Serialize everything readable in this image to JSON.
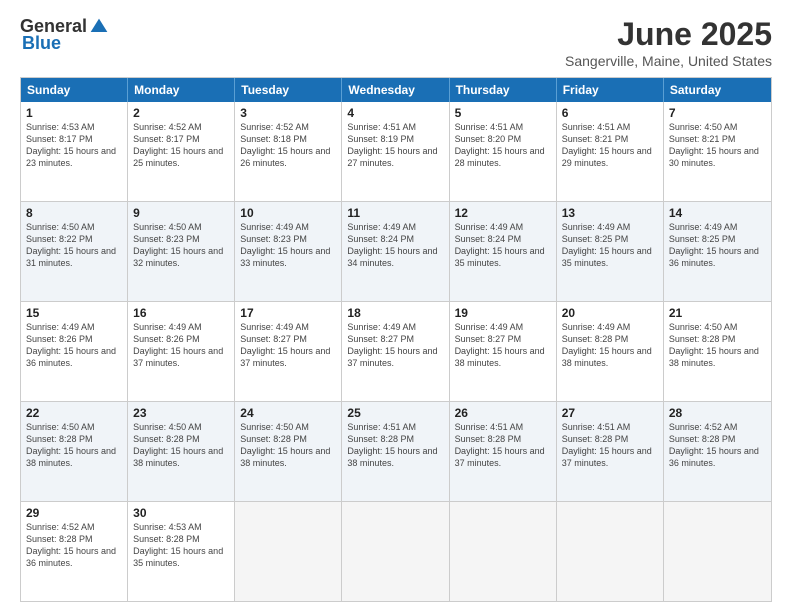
{
  "header": {
    "logo_general": "General",
    "logo_blue": "Blue",
    "title": "June 2025",
    "location": "Sangerville, Maine, United States"
  },
  "days_of_week": [
    "Sunday",
    "Monday",
    "Tuesday",
    "Wednesday",
    "Thursday",
    "Friday",
    "Saturday"
  ],
  "rows": [
    [
      {
        "day": "1",
        "sunrise": "4:53 AM",
        "sunset": "8:17 PM",
        "daylight": "15 hours and 23 minutes.",
        "shaded": false
      },
      {
        "day": "2",
        "sunrise": "4:52 AM",
        "sunset": "8:17 PM",
        "daylight": "15 hours and 25 minutes.",
        "shaded": false
      },
      {
        "day": "3",
        "sunrise": "4:52 AM",
        "sunset": "8:18 PM",
        "daylight": "15 hours and 26 minutes.",
        "shaded": false
      },
      {
        "day": "4",
        "sunrise": "4:51 AM",
        "sunset": "8:19 PM",
        "daylight": "15 hours and 27 minutes.",
        "shaded": false
      },
      {
        "day": "5",
        "sunrise": "4:51 AM",
        "sunset": "8:20 PM",
        "daylight": "15 hours and 28 minutes.",
        "shaded": false
      },
      {
        "day": "6",
        "sunrise": "4:51 AM",
        "sunset": "8:21 PM",
        "daylight": "15 hours and 29 minutes.",
        "shaded": false
      },
      {
        "day": "7",
        "sunrise": "4:50 AM",
        "sunset": "8:21 PM",
        "daylight": "15 hours and 30 minutes.",
        "shaded": false
      }
    ],
    [
      {
        "day": "8",
        "sunrise": "4:50 AM",
        "sunset": "8:22 PM",
        "daylight": "15 hours and 31 minutes.",
        "shaded": true
      },
      {
        "day": "9",
        "sunrise": "4:50 AM",
        "sunset": "8:23 PM",
        "daylight": "15 hours and 32 minutes.",
        "shaded": true
      },
      {
        "day": "10",
        "sunrise": "4:49 AM",
        "sunset": "8:23 PM",
        "daylight": "15 hours and 33 minutes.",
        "shaded": true
      },
      {
        "day": "11",
        "sunrise": "4:49 AM",
        "sunset": "8:24 PM",
        "daylight": "15 hours and 34 minutes.",
        "shaded": true
      },
      {
        "day": "12",
        "sunrise": "4:49 AM",
        "sunset": "8:24 PM",
        "daylight": "15 hours and 35 minutes.",
        "shaded": true
      },
      {
        "day": "13",
        "sunrise": "4:49 AM",
        "sunset": "8:25 PM",
        "daylight": "15 hours and 35 minutes.",
        "shaded": true
      },
      {
        "day": "14",
        "sunrise": "4:49 AM",
        "sunset": "8:25 PM",
        "daylight": "15 hours and 36 minutes.",
        "shaded": true
      }
    ],
    [
      {
        "day": "15",
        "sunrise": "4:49 AM",
        "sunset": "8:26 PM",
        "daylight": "15 hours and 36 minutes.",
        "shaded": false
      },
      {
        "day": "16",
        "sunrise": "4:49 AM",
        "sunset": "8:26 PM",
        "daylight": "15 hours and 37 minutes.",
        "shaded": false
      },
      {
        "day": "17",
        "sunrise": "4:49 AM",
        "sunset": "8:27 PM",
        "daylight": "15 hours and 37 minutes.",
        "shaded": false
      },
      {
        "day": "18",
        "sunrise": "4:49 AM",
        "sunset": "8:27 PM",
        "daylight": "15 hours and 37 minutes.",
        "shaded": false
      },
      {
        "day": "19",
        "sunrise": "4:49 AM",
        "sunset": "8:27 PM",
        "daylight": "15 hours and 38 minutes.",
        "shaded": false
      },
      {
        "day": "20",
        "sunrise": "4:49 AM",
        "sunset": "8:28 PM",
        "daylight": "15 hours and 38 minutes.",
        "shaded": false
      },
      {
        "day": "21",
        "sunrise": "4:50 AM",
        "sunset": "8:28 PM",
        "daylight": "15 hours and 38 minutes.",
        "shaded": false
      }
    ],
    [
      {
        "day": "22",
        "sunrise": "4:50 AM",
        "sunset": "8:28 PM",
        "daylight": "15 hours and 38 minutes.",
        "shaded": true
      },
      {
        "day": "23",
        "sunrise": "4:50 AM",
        "sunset": "8:28 PM",
        "daylight": "15 hours and 38 minutes.",
        "shaded": true
      },
      {
        "day": "24",
        "sunrise": "4:50 AM",
        "sunset": "8:28 PM",
        "daylight": "15 hours and 38 minutes.",
        "shaded": true
      },
      {
        "day": "25",
        "sunrise": "4:51 AM",
        "sunset": "8:28 PM",
        "daylight": "15 hours and 38 minutes.",
        "shaded": true
      },
      {
        "day": "26",
        "sunrise": "4:51 AM",
        "sunset": "8:28 PM",
        "daylight": "15 hours and 37 minutes.",
        "shaded": true
      },
      {
        "day": "27",
        "sunrise": "4:51 AM",
        "sunset": "8:28 PM",
        "daylight": "15 hours and 37 minutes.",
        "shaded": true
      },
      {
        "day": "28",
        "sunrise": "4:52 AM",
        "sunset": "8:28 PM",
        "daylight": "15 hours and 36 minutes.",
        "shaded": true
      }
    ],
    [
      {
        "day": "29",
        "sunrise": "4:52 AM",
        "sunset": "8:28 PM",
        "daylight": "15 hours and 36 minutes.",
        "shaded": false
      },
      {
        "day": "30",
        "sunrise": "4:53 AM",
        "sunset": "8:28 PM",
        "daylight": "15 hours and 35 minutes.",
        "shaded": false
      },
      {
        "day": "",
        "sunrise": "",
        "sunset": "",
        "daylight": "",
        "shaded": false,
        "empty": true
      },
      {
        "day": "",
        "sunrise": "",
        "sunset": "",
        "daylight": "",
        "shaded": false,
        "empty": true
      },
      {
        "day": "",
        "sunrise": "",
        "sunset": "",
        "daylight": "",
        "shaded": false,
        "empty": true
      },
      {
        "day": "",
        "sunrise": "",
        "sunset": "",
        "daylight": "",
        "shaded": false,
        "empty": true
      },
      {
        "day": "",
        "sunrise": "",
        "sunset": "",
        "daylight": "",
        "shaded": false,
        "empty": true
      }
    ]
  ]
}
